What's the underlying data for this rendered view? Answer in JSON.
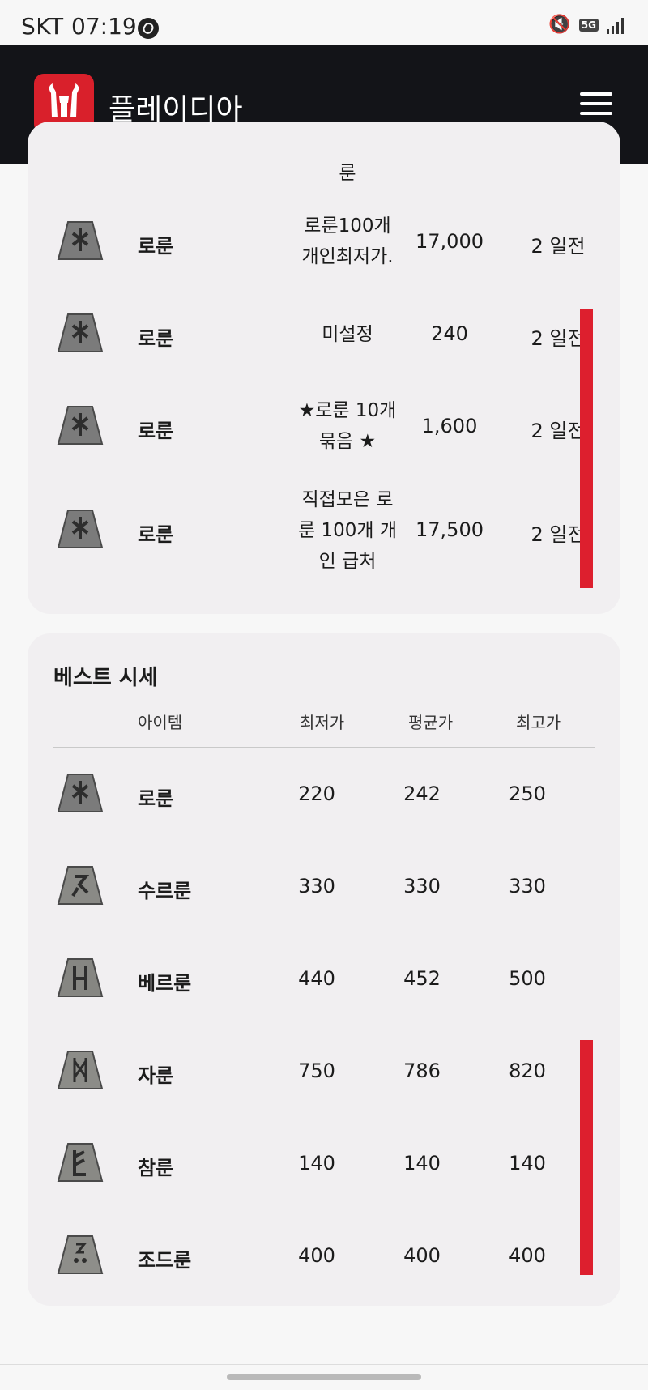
{
  "status": {
    "carrier": "SKT",
    "time": "07:19",
    "network": "5G"
  },
  "header": {
    "brand": "플레이디아",
    "logo_icon": "playdia-logo-icon",
    "menu_icon": "hamburger-menu-icon"
  },
  "colors": {
    "accent": "#dd1f2e",
    "header_bg": "#131418",
    "card_bg": "#f1eff1"
  },
  "listings": {
    "cut_desc": "룬",
    "rows": [
      {
        "name": "로룬",
        "desc_lines": [
          "로룬100개",
          "개인최저가."
        ],
        "price": "17,000",
        "when": "2 일전"
      },
      {
        "name": "로룬",
        "desc_lines": [
          "미설정"
        ],
        "price": "240",
        "when": "2 일전"
      },
      {
        "name": "로룬",
        "desc_lines": [
          "★로룬 10개",
          "묶음 ★"
        ],
        "price": "1,600",
        "when": "2 일전"
      },
      {
        "name": "로룬",
        "desc_lines": [
          "직접모은 로",
          "룬 100개 개",
          "인 급처"
        ],
        "price": "17,500",
        "when": "2 일전"
      }
    ]
  },
  "best": {
    "title": "베스트 시세",
    "headers": {
      "item": "아이템",
      "low": "최저가",
      "avg": "평균가",
      "high": "최고가"
    },
    "rows": [
      {
        "name": "로룬",
        "low": "220",
        "avg": "242",
        "high": "250"
      },
      {
        "name": "수르룬",
        "low": "330",
        "avg": "330",
        "high": "330"
      },
      {
        "name": "베르룬",
        "low": "440",
        "avg": "452",
        "high": "500"
      },
      {
        "name": "자룬",
        "low": "750",
        "avg": "786",
        "high": "820"
      },
      {
        "name": "참룬",
        "low": "140",
        "avg": "140",
        "high": "140"
      },
      {
        "name": "조드룬",
        "low": "400",
        "avg": "400",
        "high": "400"
      }
    ]
  }
}
